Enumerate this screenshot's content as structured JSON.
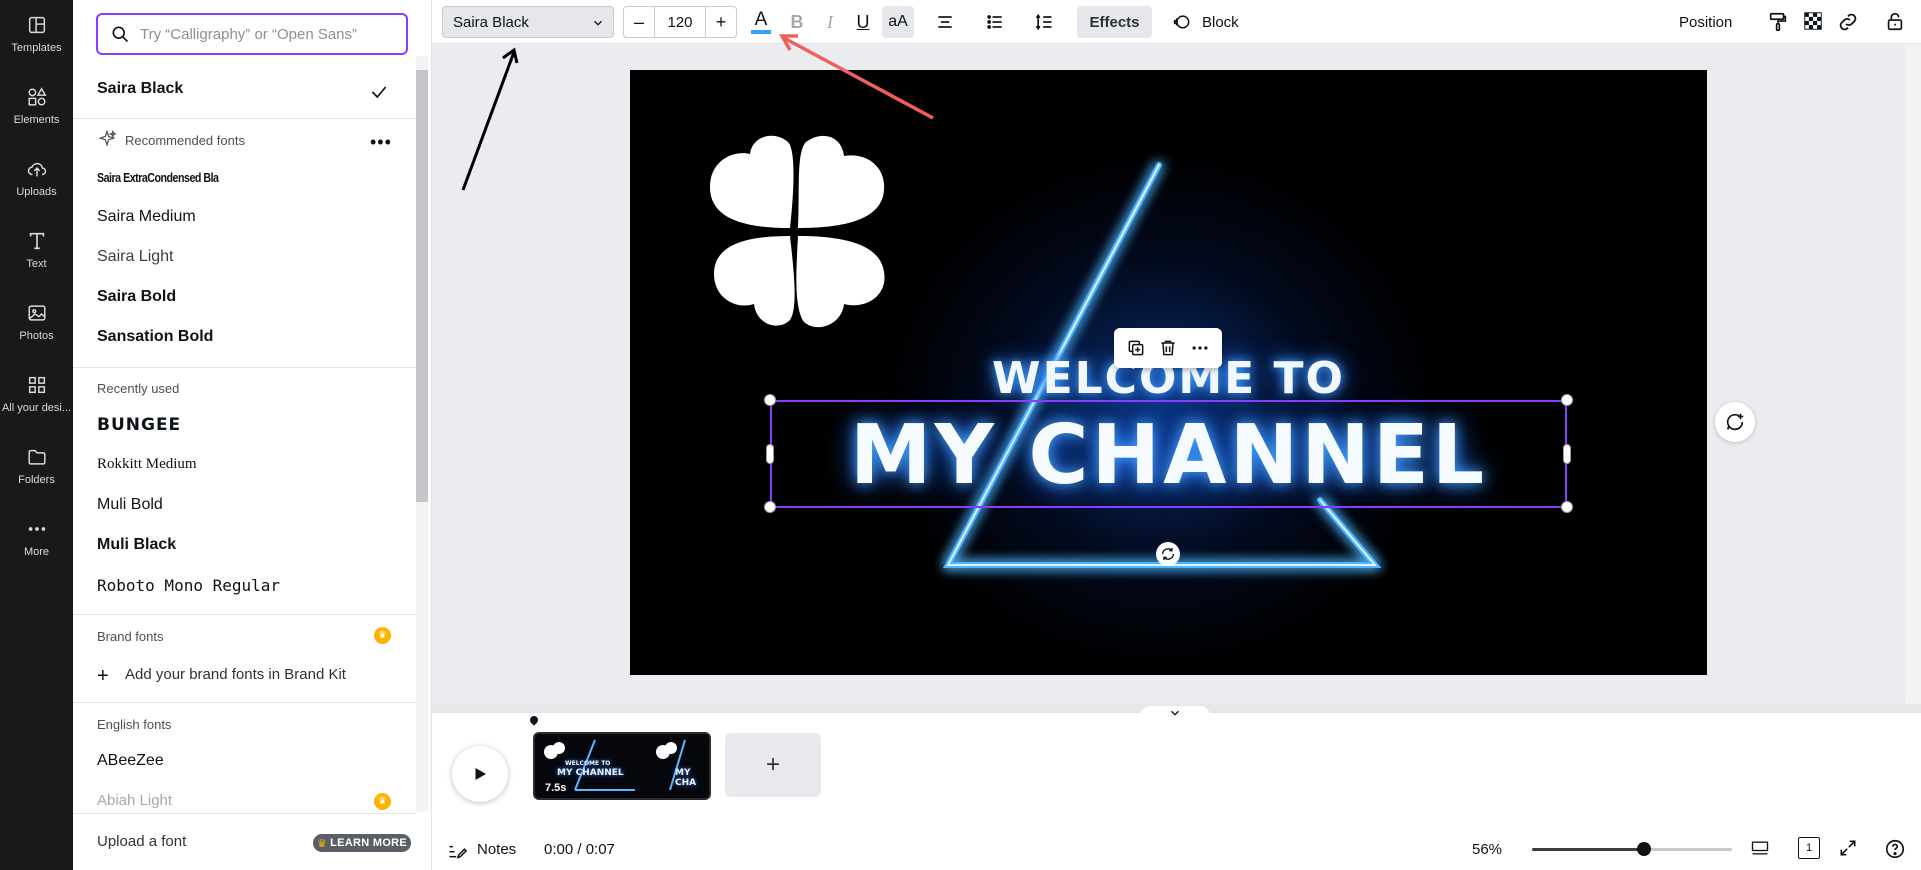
{
  "rail": {
    "items": [
      {
        "label": "Templates",
        "icon": "templates-icon"
      },
      {
        "label": "Elements",
        "icon": "elements-icon"
      },
      {
        "label": "Uploads",
        "icon": "uploads-icon"
      },
      {
        "label": "Text",
        "icon": "text-icon"
      },
      {
        "label": "Photos",
        "icon": "photos-icon"
      },
      {
        "label": "All your desi...",
        "icon": "all-designs-icon"
      },
      {
        "label": "Folders",
        "icon": "folders-icon"
      },
      {
        "label": "More",
        "icon": "more-icon"
      }
    ]
  },
  "font_panel": {
    "search_placeholder": "Try “Calligraphy” or “Open Sans”",
    "selected_font": "Saira Black",
    "recommended_label": "Recommended fonts",
    "recommended": [
      "Saira ExtraCondensed Bla",
      "Saira Medium",
      "Saira Light",
      "Saira Bold",
      "Sansation Bold"
    ],
    "recently_used_label": "Recently used",
    "recently_used": [
      "BUNGEE",
      "Rokkitt Medium",
      "Muli Bold",
      "Muli Black",
      "Roboto Mono Regular"
    ],
    "brand_label": "Brand fonts",
    "brand_add": "Add your brand fonts in Brand Kit",
    "english_label": "English fonts",
    "english": [
      "ABeeZee",
      "Abiah Light"
    ],
    "upload_label": "Upload a font",
    "learn_more": "LEARN MORE"
  },
  "toolbar": {
    "font_name": "Saira Black",
    "font_size": "120",
    "minus": "–",
    "plus": "+",
    "effects": "Effects",
    "block": "Block",
    "position": "Position",
    "text_color": "#3b9dff"
  },
  "canvas": {
    "line1": "WELCOME TO",
    "line2": "MY CHANNEL"
  },
  "timeline": {
    "thumb_line1": "WELCOME TO",
    "thumb_line2": "MY CHANNEL",
    "duration": "7.5s",
    "notes": "Notes",
    "time": "0:00 / 0:07",
    "zoom": "56%",
    "zoom_fraction": 0.56,
    "page_count": "1"
  }
}
